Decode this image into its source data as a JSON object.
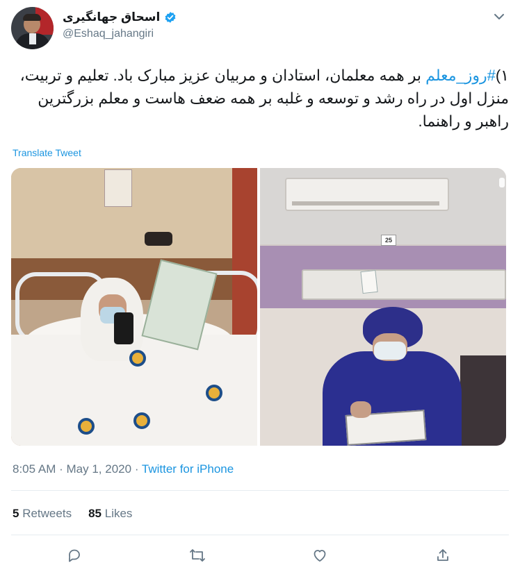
{
  "tweet": {
    "display_name": "اسحاق جهانگیری",
    "handle": "@Eshaq_jahangiri",
    "text_prefix": "۱)",
    "hashtag": "#روز_معلم",
    "text_rest": " بر همه معلمان، استادان و مربیان عزیز مبارک باد. تعلیم و تربیت، منزل اول در راه رشد و توسعه و غلبه بر همه ضعف هاست و معلم بزرگترین راهبر و راهنما.",
    "translate_label": "Translate Tweet",
    "time": "8:05 AM",
    "separator": "·",
    "date": "May 1, 2020",
    "source": "Twitter for iPhone",
    "photo_right_room_number": "25"
  },
  "stats": {
    "retweets_count": "5",
    "retweets_label": "Retweets",
    "likes_count": "85",
    "likes_label": "Likes"
  },
  "icons": {
    "verified": "verified-badge-icon",
    "caret": "chevron-down-icon",
    "reply": "reply-icon",
    "retweet": "retweet-icon",
    "like": "heart-icon",
    "share": "share-icon"
  },
  "colors": {
    "link": "#1b95e0",
    "muted": "#657786",
    "text": "#14171a",
    "divider": "#e6ecf0"
  }
}
